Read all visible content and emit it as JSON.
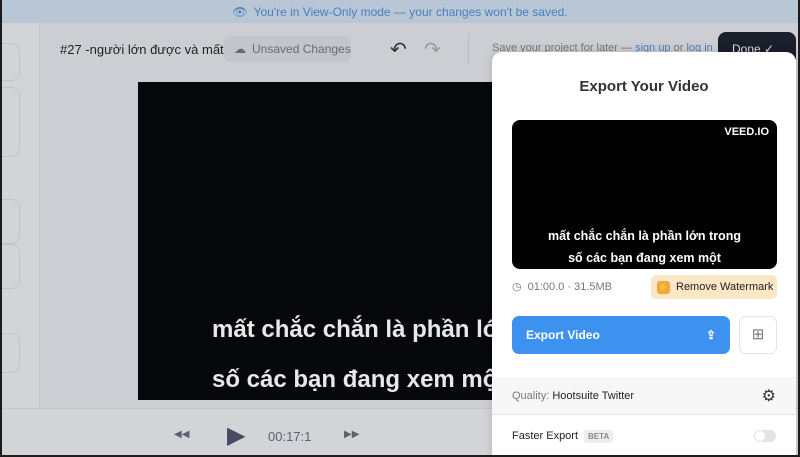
{
  "banner": {
    "text": "You're in View-Only mode — your changes won't be saved."
  },
  "header": {
    "project_title": "#27 -người lớn được và mất",
    "unsaved": "Unsaved Changes",
    "save_prompt": "Save your project for later —",
    "sign_up": "sign up",
    "or": "or",
    "log_in": "log in",
    "done": "Done"
  },
  "video": {
    "caption_line1": "mất chắc chắn là phần lớn trong",
    "caption_line2": "số các bạn đang xem một"
  },
  "player": {
    "time": "00:17:1"
  },
  "export_panel": {
    "title": "Export Your Video",
    "watermark": "VEED.IO",
    "caption_line1": "mất chắc chắn là phần lớn trong",
    "caption_line2": "số các bạn đang xem một",
    "meta": "01:00.0 · 31.5MB",
    "remove_watermark": "Remove Watermark",
    "export_button": "Export Video",
    "quality_label": "Quality:",
    "quality_value": "Hootsuite Twitter",
    "faster_export": "Faster Export",
    "beta": "BETA"
  }
}
